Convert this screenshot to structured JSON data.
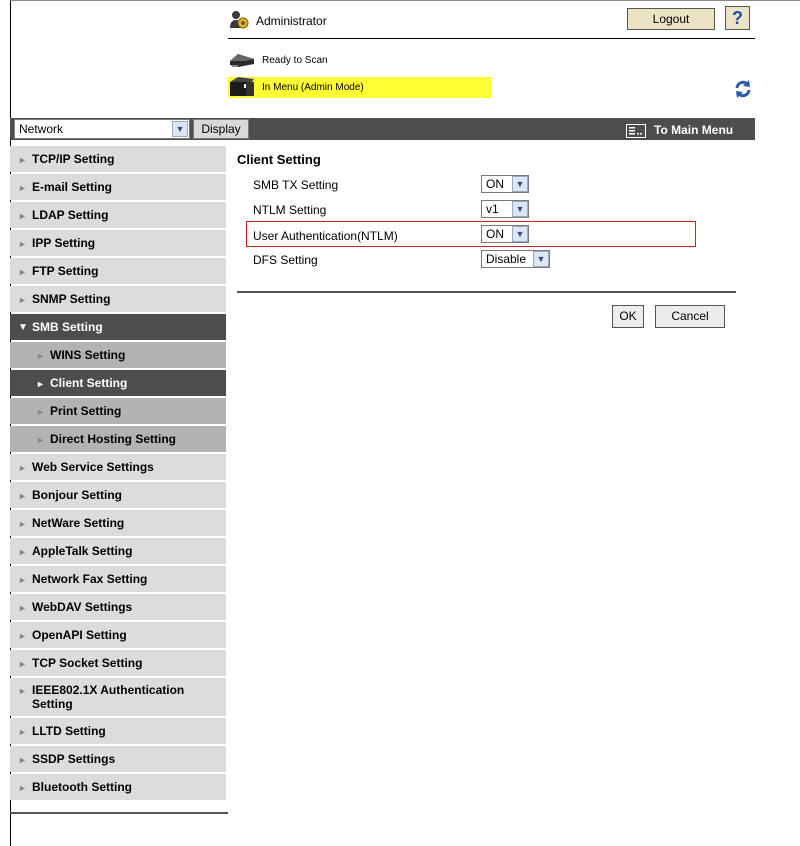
{
  "header": {
    "user_label": "Administrator",
    "logout_label": "Logout",
    "help_label": "?",
    "status_ready": "Ready to Scan",
    "status_menu": "In Menu (Admin Mode)"
  },
  "topbar": {
    "category_selected": "Network",
    "display_label": "Display",
    "main_menu_label": "To Main Menu"
  },
  "sidebar": {
    "items": [
      {
        "label": "TCP/IP Setting"
      },
      {
        "label": "E-mail Setting"
      },
      {
        "label": "LDAP Setting"
      },
      {
        "label": "IPP Setting"
      },
      {
        "label": "FTP Setting"
      },
      {
        "label": "SNMP Setting"
      },
      {
        "label": "SMB Setting"
      },
      {
        "label": "WINS Setting"
      },
      {
        "label": "Client Setting"
      },
      {
        "label": "Print Setting"
      },
      {
        "label": "Direct Hosting Setting"
      },
      {
        "label": "Web Service Settings"
      },
      {
        "label": "Bonjour Setting"
      },
      {
        "label": "NetWare Setting"
      },
      {
        "label": "AppleTalk Setting"
      },
      {
        "label": "Network Fax Setting"
      },
      {
        "label": "WebDAV Settings"
      },
      {
        "label": "OpenAPI Setting"
      },
      {
        "label": "TCP Socket Setting"
      },
      {
        "label": "IEEE802.1X Authentication Setting"
      },
      {
        "label": "LLTD Setting"
      },
      {
        "label": "SSDP Settings"
      },
      {
        "label": "Bluetooth Setting"
      }
    ]
  },
  "main": {
    "title": "Client Setting",
    "rows": [
      {
        "label": "SMB TX Setting",
        "value": "ON"
      },
      {
        "label": "NTLM Setting",
        "value": "v1"
      },
      {
        "label": "User Authentication(NTLM)",
        "value": "ON"
      },
      {
        "label": "DFS Setting",
        "value": "Disable"
      }
    ],
    "ok_label": "OK",
    "cancel_label": "Cancel"
  },
  "colors": {
    "nav_dark": "#4d4d4d",
    "nav_light": "#dcdcdc",
    "nav_sub": "#b3b3b3",
    "status_highlight": "#ffff33",
    "highlight_border": "#cc2222"
  },
  "icons": {
    "admin": "admin-user-icon",
    "help": "help-icon",
    "scanner": "scanner-icon",
    "printer": "printer-icon",
    "refresh": "refresh-icon",
    "main_menu": "main-menu-icon",
    "dropdown": "chevron-down-icon"
  }
}
